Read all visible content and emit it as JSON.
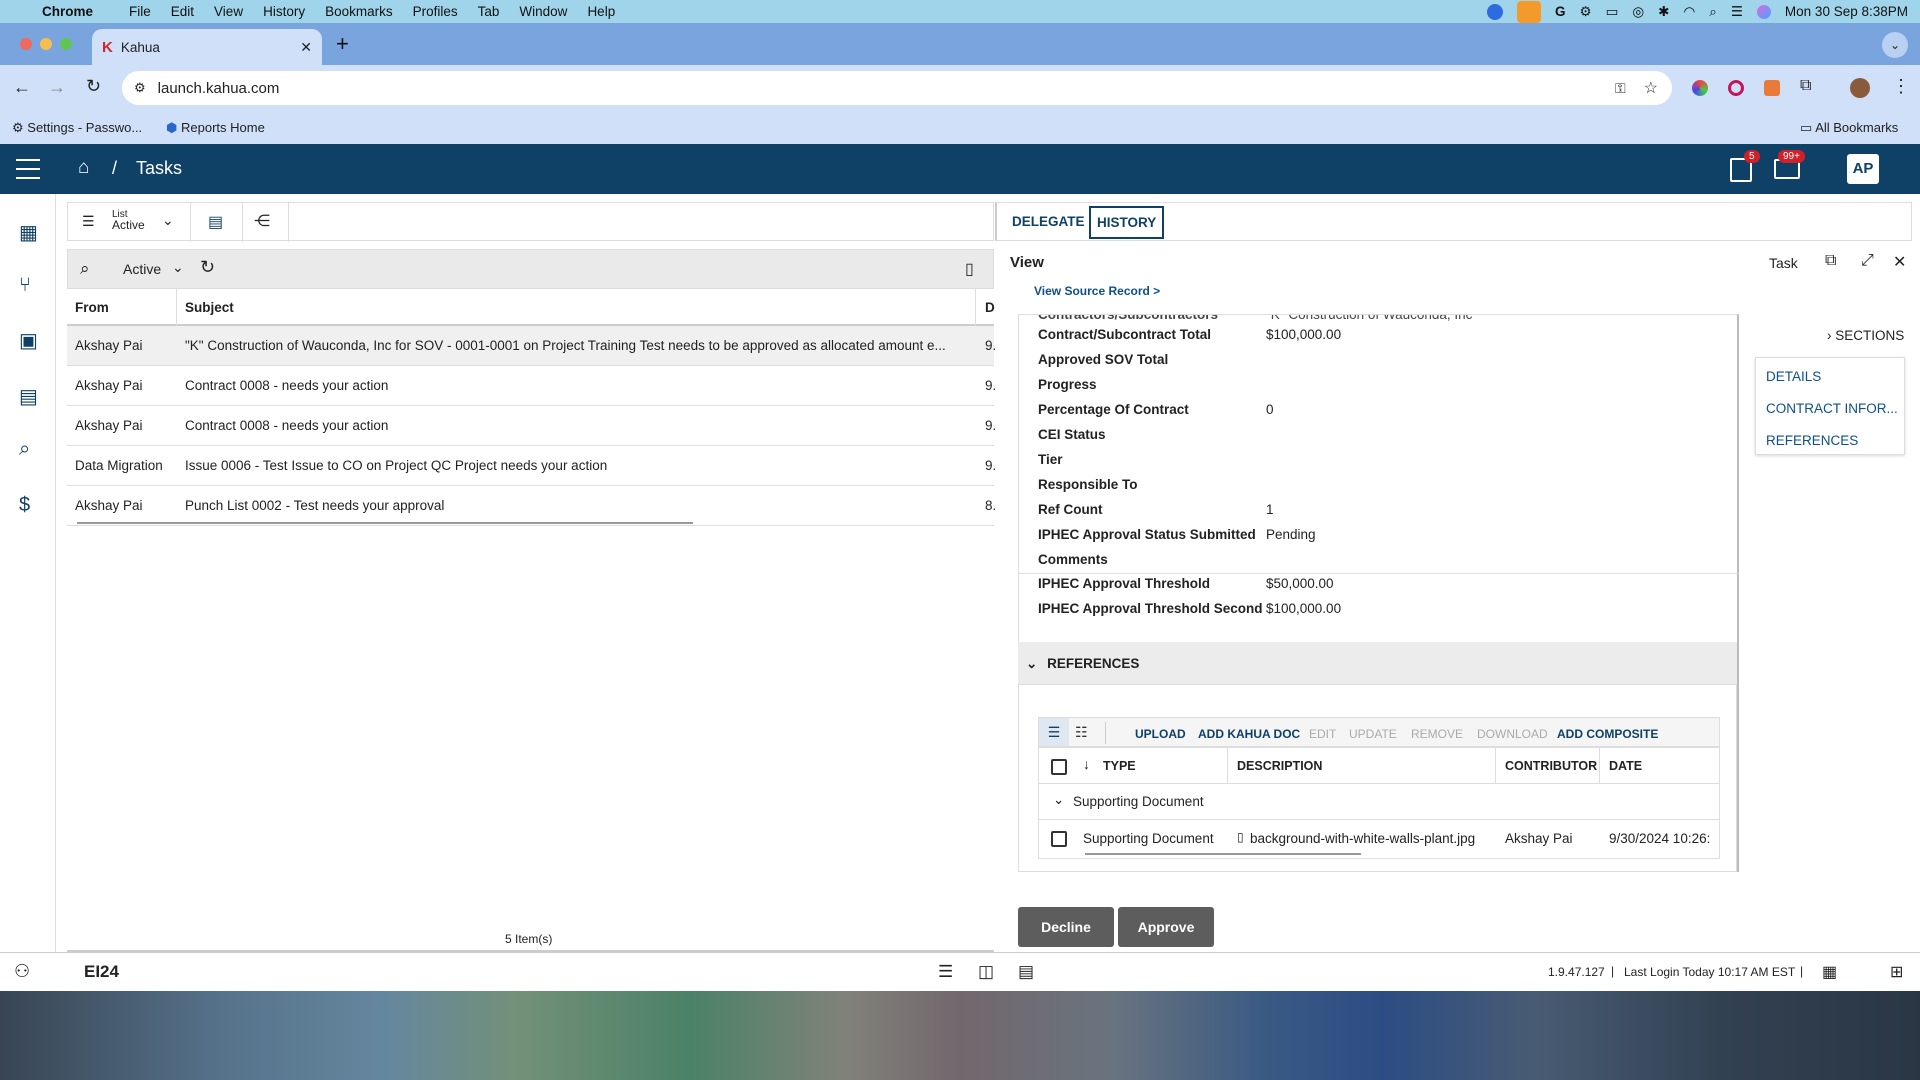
{
  "menubar": {
    "app": "Chrome",
    "items": [
      "File",
      "Edit",
      "View",
      "History",
      "Bookmarks",
      "Profiles",
      "Tab",
      "Window",
      "Help"
    ],
    "datetime": "Mon 30 Sep  8:38PM"
  },
  "browser": {
    "tab_title": "Kahua",
    "url": "launch.kahua.com",
    "bookmarks": [
      "Settings - Passwo...",
      "Reports Home"
    ],
    "all_bookmarks": "All Bookmarks"
  },
  "app": {
    "breadcrumb_sep": "/",
    "title": "Tasks",
    "tasks_badge": "5",
    "inbox_badge": "99+",
    "avatar": "AP"
  },
  "list": {
    "view_label_top": "List",
    "view_label_bottom": "Active",
    "filter": "Active",
    "columns": [
      "From",
      "Subject",
      "D"
    ],
    "rows": [
      {
        "from": "Akshay Pai",
        "subject": "\"K\" Construction of Wauconda, Inc for SOV - 0001-0001 on Project Training Test needs to be approved as allocated amount  e...",
        "d": "9."
      },
      {
        "from": "Akshay Pai",
        "subject": "Contract 0008 -  needs your action",
        "d": "9."
      },
      {
        "from": "Akshay Pai",
        "subject": "Contract 0008 -  needs your action",
        "d": "9."
      },
      {
        "from": "Data Migration",
        "subject": "Issue 0006 - Test Issue to CO on Project QC Project needs your action",
        "d": "9."
      },
      {
        "from": "Akshay Pai",
        "subject": "Punch List 0002 - Test needs your approval",
        "d": "8."
      }
    ],
    "count": "5  Item(s)"
  },
  "detail": {
    "tabs": [
      "DELEGATE",
      "HISTORY"
    ],
    "view_title": "View",
    "task_label": "Task",
    "source_link": "View Source Record >",
    "fields": [
      {
        "label": "Contract/Subcontract Total",
        "value": "$100,000.00"
      },
      {
        "label": "Approved SOV Total",
        "value": ""
      },
      {
        "label": "Progress",
        "value": ""
      },
      {
        "label": "Percentage Of Contract",
        "value": "0"
      },
      {
        "label": "CEI Status",
        "value": ""
      },
      {
        "label": "Tier",
        "value": ""
      },
      {
        "label": "Responsible To",
        "value": ""
      },
      {
        "label": "Ref Count",
        "value": "1"
      },
      {
        "label": "IPHEC Approval Status Submitted",
        "value": "Pending"
      },
      {
        "label": "Comments",
        "value": ""
      },
      {
        "label": "IPHEC Approval Threshold",
        "value": "$50,000.00"
      },
      {
        "label": "IPHEC Approval Threshold Second",
        "value": "$100,000.00"
      }
    ],
    "sections_label": "SECTIONS",
    "sections": [
      "DETAILS",
      "CONTRACT INFOR...",
      "REFERENCES"
    ],
    "references_title": "REFERENCES",
    "ref_actions": [
      {
        "label": "UPLOAD",
        "enabled": true
      },
      {
        "label": "ADD KAHUA DOC",
        "enabled": true
      },
      {
        "label": "EDIT",
        "enabled": false
      },
      {
        "label": "UPDATE",
        "enabled": false
      },
      {
        "label": "REMOVE",
        "enabled": false
      },
      {
        "label": "DOWNLOAD",
        "enabled": false
      },
      {
        "label": "ADD COMPOSITE",
        "enabled": true
      }
    ],
    "ref_columns": [
      "TYPE",
      "DESCRIPTION",
      "CONTRIBUTOR",
      "DATE"
    ],
    "ref_group": "Supporting Document",
    "ref_row": {
      "type": "Supporting Document",
      "description": "background-with-white-walls-plant.jpg",
      "contributor": "Akshay Pai",
      "date": "9/30/2024 10:26:"
    },
    "decline": "Decline",
    "approve": "Approve"
  },
  "footer": {
    "brand": "EI24",
    "version": "1.9.47.127",
    "last_login": "Last Login Today 10:17 AM EST"
  },
  "colors": {
    "header": "#0f4066",
    "link": "#0f4f8c",
    "menubar": "#9fd4ea",
    "chrome_tabstrip": "#7aa4de",
    "chrome_toolbar": "#cfe0f8"
  }
}
